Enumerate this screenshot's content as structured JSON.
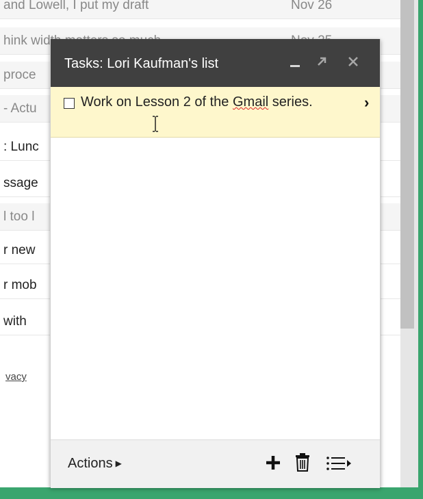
{
  "email_rows": [
    {
      "snippet": "and Lowell, I put my draft",
      "date": "Nov 26",
      "unread": false
    },
    {
      "snippet": "hink width matters so much",
      "date": "Nov 25",
      "unread": false
    },
    {
      "snippet": "proce",
      "date": "",
      "unread": false
    },
    {
      "snippet": "- Actu",
      "date": "",
      "unread": false
    },
    {
      "snippet": ": Lunc",
      "date": "",
      "unread": true
    },
    {
      "snippet": "ssage",
      "date": "",
      "unread": true
    },
    {
      "snippet": "l too l",
      "date": "",
      "unread": false
    },
    {
      "snippet": "r new",
      "date": "",
      "unread": true
    },
    {
      "snippet": "r mob",
      "date": "",
      "unread": true
    },
    {
      "snippet": "with",
      "date": "",
      "unread": true
    }
  ],
  "privacy_link": "vacy",
  "tasks": {
    "title": "Tasks: Lori Kaufman's list",
    "items": [
      {
        "text_before": "Work on Lesson 2 of the ",
        "text_misspelled": "Gmail",
        "text_after": " series.",
        "checked": false
      }
    ],
    "actions_label": "Actions",
    "icons": {
      "minimize": "minimize-icon",
      "popout": "popout-arrow-icon",
      "close": "close-icon",
      "add": "plus-icon",
      "delete": "trash-icon",
      "lists": "list-menu-icon"
    }
  },
  "colors": {
    "header_bg": "#404040",
    "task_highlight": "#fef7cc",
    "frame_green": "#3aa56e"
  }
}
